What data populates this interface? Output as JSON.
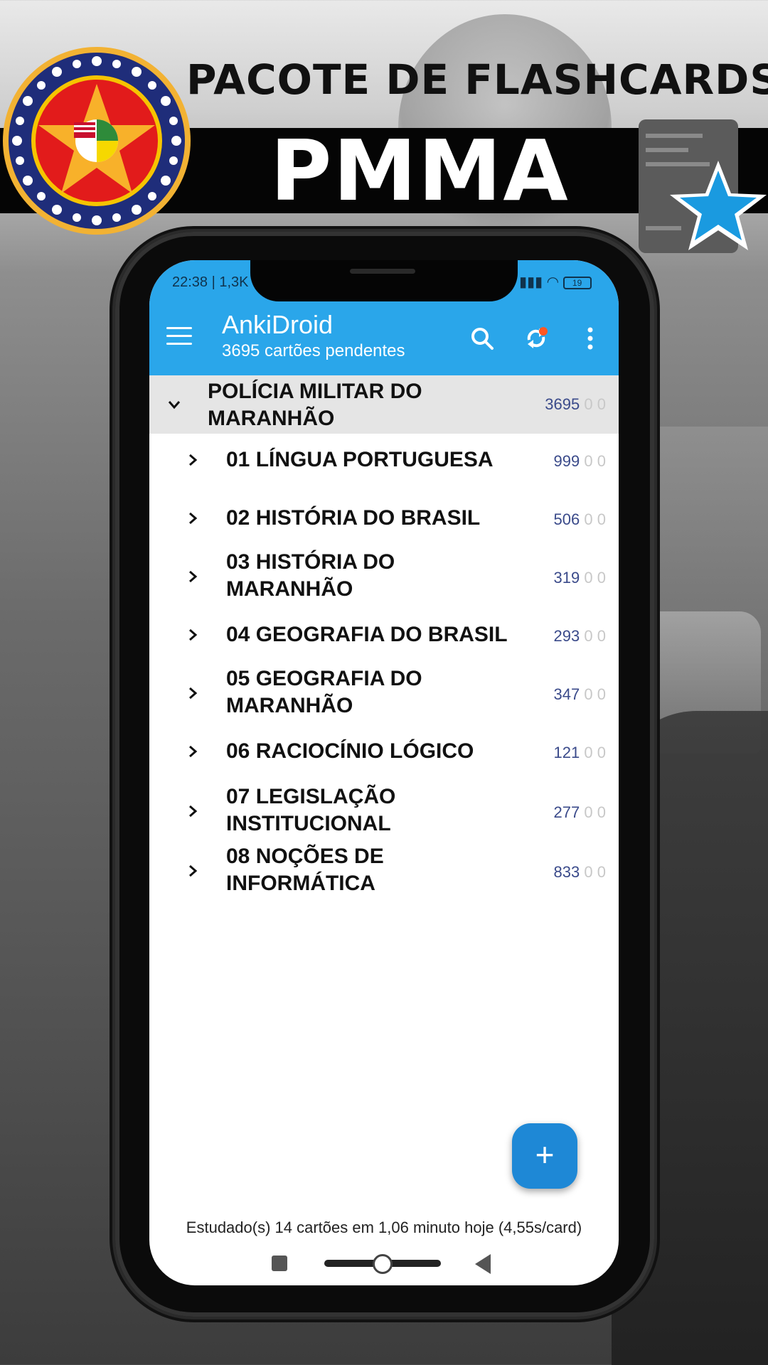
{
  "banner": {
    "title_top": "PACOTE DE FLASHCARDS",
    "title_main": "PMMA"
  },
  "status_bar": {
    "time": "22:38 | 1,3K",
    "battery": "19"
  },
  "toolbar": {
    "app_name": "AnkiDroid",
    "subtitle": "3695 cartões pendentes",
    "icons": [
      "menu-icon",
      "search-icon",
      "sync-icon",
      "more-vert-icon"
    ]
  },
  "decks": {
    "parent": {
      "name_line1": "POLÍCIA MILITAR DO",
      "name_line2": "MARANHÃO",
      "new": "3695",
      "learn": "0",
      "review": "0"
    },
    "children": [
      {
        "line1": "01 LÍNGUA PORTUGUESA",
        "line2": "",
        "new": "999",
        "learn": "0",
        "review": "0"
      },
      {
        "line1": "02 HISTÓRIA DO BRASIL",
        "line2": "",
        "new": "506",
        "learn": "0",
        "review": "0"
      },
      {
        "line1": "03 HISTÓRIA DO",
        "line2": "MARANHÃO",
        "new": "319",
        "learn": "0",
        "review": "0"
      },
      {
        "line1": "04 GEOGRAFIA DO BRASIL",
        "line2": "",
        "new": "293",
        "learn": "0",
        "review": "0"
      },
      {
        "line1": "05 GEOGRAFIA DO",
        "line2": "MARANHÃO",
        "new": "347",
        "learn": "0",
        "review": "0"
      },
      {
        "line1": "06 RACIOCÍNIO LÓGICO",
        "line2": "",
        "new": "121",
        "learn": "0",
        "review": "0"
      },
      {
        "line1": "07 LEGISLAÇÃO",
        "line2": "INSTITUCIONAL",
        "new": "277",
        "learn": "0",
        "review": "0"
      },
      {
        "line1": "08 NOÇÕES DE",
        "line2": "INFORMÁTICA",
        "new": "833",
        "learn": "0",
        "review": "0"
      }
    ]
  },
  "fab": {
    "label": "+"
  },
  "footer": {
    "stats": "Estudado(s) 14 cartões em 1,06 minuto hoje (4,55s/card)"
  },
  "colors": {
    "accent": "#2aa6ea",
    "fab": "#1e88d6",
    "new_count": "#3a4a8a"
  }
}
